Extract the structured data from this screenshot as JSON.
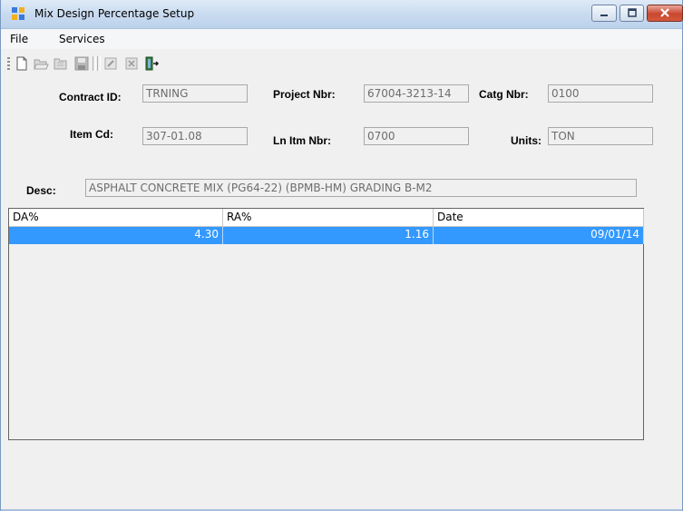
{
  "window": {
    "title": "Mix Design Percentage Setup"
  },
  "menu": {
    "file": "File",
    "services": "Services"
  },
  "form": {
    "contract_id_label": "Contract ID:",
    "contract_id_value": "TRNING",
    "project_nbr_label": "Project Nbr:",
    "project_nbr_value": "67004-3213-14",
    "catg_nbr_label": "Catg Nbr:",
    "catg_nbr_value": "0100",
    "item_cd_label": "Item Cd:",
    "item_cd_value": "307-01.08",
    "ln_itm_nbr_label": "Ln Itm Nbr:",
    "ln_itm_nbr_value": "0700",
    "units_label": "Units:",
    "units_value": "TON",
    "desc_label": "Desc:",
    "desc_value": "ASPHALT CONCRETE MIX (PG64-22) (BPMB-HM) GRADING B-M2"
  },
  "grid": {
    "columns": [
      "DA%",
      "RA%",
      "Date"
    ],
    "rows": [
      {
        "da": "4.30",
        "ra": "1.16",
        "date": "09/01/14"
      }
    ]
  },
  "colors": {
    "selection": "#3399ff",
    "title_gradient": "#c9dbf0",
    "close_button": "#c9462f"
  },
  "icons": [
    "app-icon",
    "minimize-icon",
    "maximize-icon",
    "close-icon",
    "new-icon",
    "open-icon",
    "folder-icon",
    "save-icon",
    "edit-icon",
    "delete-icon",
    "exit-icon"
  ]
}
